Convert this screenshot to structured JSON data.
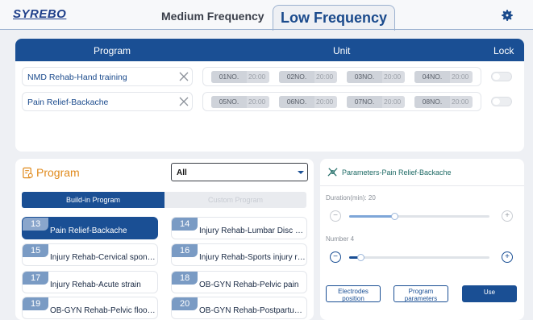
{
  "brand": "SYREBO",
  "tabs": [
    {
      "label": "Medium Frequency",
      "active": false
    },
    {
      "label": "Low Frequency",
      "active": true
    }
  ],
  "icons": {
    "settings": "gear-icon",
    "program": "document-list-icon",
    "parameters": "electrode-wave-icon",
    "clear": "close-icon",
    "dropdown": "caret-down-icon"
  },
  "colors": {
    "primary": "#1a4f94",
    "accent": "#e08a1c",
    "teal": "#1f6b66"
  },
  "unit_table": {
    "headers": {
      "program": "Program",
      "unit": "Unit",
      "lock": "Lock"
    },
    "rows": [
      {
        "program": "NMD Rehab-Hand training",
        "units": [
          {
            "no": "01NO.",
            "time": "20:00"
          },
          {
            "no": "02NO.",
            "time": "20:00"
          },
          {
            "no": "03NO.",
            "time": "20:00"
          },
          {
            "no": "04NO.",
            "time": "20:00"
          }
        ],
        "locked": false
      },
      {
        "program": "Pain Relief-Backache",
        "units": [
          {
            "no": "05NO.",
            "time": "20:00"
          },
          {
            "no": "06NO.",
            "time": "20:00"
          },
          {
            "no": "07NO.",
            "time": "20:00"
          },
          {
            "no": "08NO.",
            "time": "20:00"
          }
        ],
        "locked": false
      }
    ]
  },
  "program_panel": {
    "title": "Program",
    "filter_value": "All",
    "segments": [
      "Build-in Program",
      "Custom Program"
    ],
    "active_segment": 0,
    "programs": [
      {
        "num": "13",
        "name": "Pain Relief-Backache",
        "selected": true
      },
      {
        "num": "14",
        "name": "Injury Rehab-Lumbar Disc H...",
        "selected": false
      },
      {
        "num": "15",
        "name": "Injury Rehab-Cervical spond...",
        "selected": false
      },
      {
        "num": "16",
        "name": "Injury Rehab-Sports injury re...",
        "selected": false
      },
      {
        "num": "17",
        "name": "Injury Rehab-Acute strain",
        "selected": false
      },
      {
        "num": "18",
        "name": "OB-GYN Rehab-Pelvic pain",
        "selected": false
      },
      {
        "num": "19",
        "name": "OB-GYN Rehab-Pelvic floor r...",
        "selected": false
      },
      {
        "num": "20",
        "name": "OB-GYN Rehab-Postpartum ...",
        "selected": false
      }
    ]
  },
  "parameters": {
    "title": "Parameters-Pain Relief-Backache",
    "duration": {
      "label": "Duration(min): 20",
      "fraction": 0.32
    },
    "number": {
      "label": "Number 4",
      "fraction": 0.08
    },
    "minus": "−",
    "plus": "+",
    "buttons": {
      "electrodes": [
        "Electrodes",
        "position"
      ],
      "program_params": [
        "Program",
        "parameters"
      ],
      "use": "Use"
    }
  }
}
